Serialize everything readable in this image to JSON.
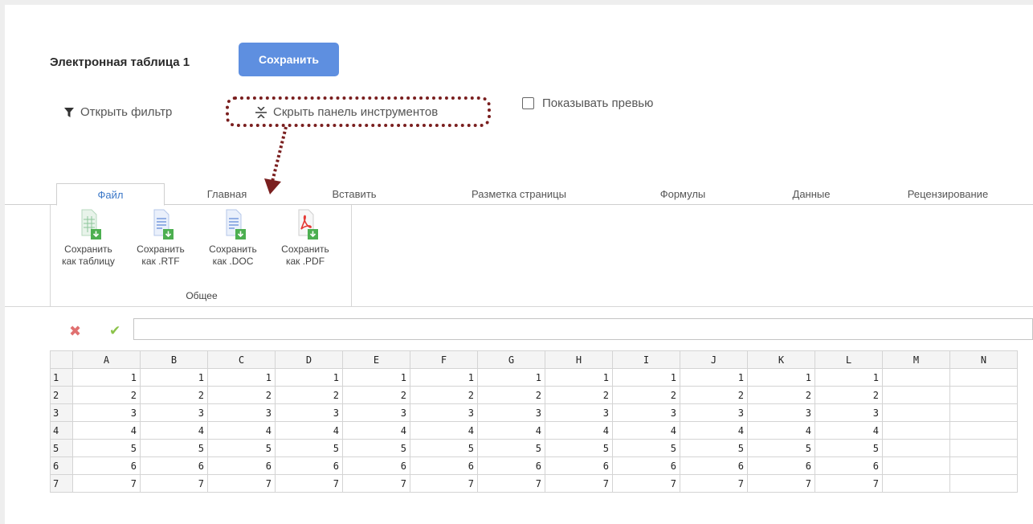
{
  "header": {
    "title": "Электронная таблица 1",
    "save_label": "Сохранить"
  },
  "toolbar": {
    "filter_label": "Открыть фильтр",
    "hide_panel_label": "Скрыть панель инструментов",
    "preview_label": "Показывать превью",
    "preview_checked": false
  },
  "tabs": [
    {
      "label": "Файл",
      "active": true
    },
    {
      "label": "Главная"
    },
    {
      "label": "Вставить"
    },
    {
      "label": "Разметка страницы"
    },
    {
      "label": "Формулы"
    },
    {
      "label": "Данные"
    },
    {
      "label": "Рецензирование"
    }
  ],
  "ribbon": {
    "buttons": [
      {
        "line1": "Сохранить",
        "line2": "как таблицу",
        "icon": "spreadsheet-download-icon"
      },
      {
        "line1": "Сохранить",
        "line2": "как .RTF",
        "icon": "rtf-download-icon"
      },
      {
        "line1": "Сохранить",
        "line2": "как .DOC",
        "icon": "doc-download-icon"
      },
      {
        "line1": "Сохранить",
        "line2": "как .PDF",
        "icon": "pdf-download-icon"
      }
    ],
    "group_label": "Общее"
  },
  "formula_bar": {
    "cancel_icon": "cancel-x-icon",
    "confirm_icon": "check-icon",
    "value": ""
  },
  "sheet": {
    "columns": [
      "A",
      "B",
      "C",
      "D",
      "E",
      "F",
      "G",
      "H",
      "I",
      "J",
      "K",
      "L",
      "M",
      "N"
    ],
    "rows": [
      {
        "n": "1",
        "cells": [
          "1",
          "1",
          "1",
          "1",
          "1",
          "1",
          "1",
          "1",
          "1",
          "1",
          "1",
          "1",
          "",
          ""
        ]
      },
      {
        "n": "2",
        "cells": [
          "2",
          "2",
          "2",
          "2",
          "2",
          "2",
          "2",
          "2",
          "2",
          "2",
          "2",
          "2",
          "",
          ""
        ]
      },
      {
        "n": "3",
        "cells": [
          "3",
          "3",
          "3",
          "3",
          "3",
          "3",
          "3",
          "3",
          "3",
          "3",
          "3",
          "3",
          "",
          ""
        ]
      },
      {
        "n": "4",
        "cells": [
          "4",
          "4",
          "4",
          "4",
          "4",
          "4",
          "4",
          "4",
          "4",
          "4",
          "4",
          "4",
          "",
          ""
        ]
      },
      {
        "n": "5",
        "cells": [
          "5",
          "5",
          "5",
          "5",
          "5",
          "5",
          "5",
          "5",
          "5",
          "5",
          "5",
          "5",
          "",
          ""
        ]
      },
      {
        "n": "6",
        "cells": [
          "6",
          "6",
          "6",
          "6",
          "6",
          "6",
          "6",
          "6",
          "6",
          "6",
          "6",
          "6",
          "",
          ""
        ]
      },
      {
        "n": "7",
        "cells": [
          "7",
          "7",
          "7",
          "7",
          "7",
          "7",
          "7",
          "7",
          "7",
          "7",
          "7",
          "7",
          "",
          ""
        ]
      }
    ]
  },
  "colors": {
    "accent": "#5e8fe0",
    "highlight": "#7a1f1f",
    "active_tab": "#3c78c8"
  }
}
